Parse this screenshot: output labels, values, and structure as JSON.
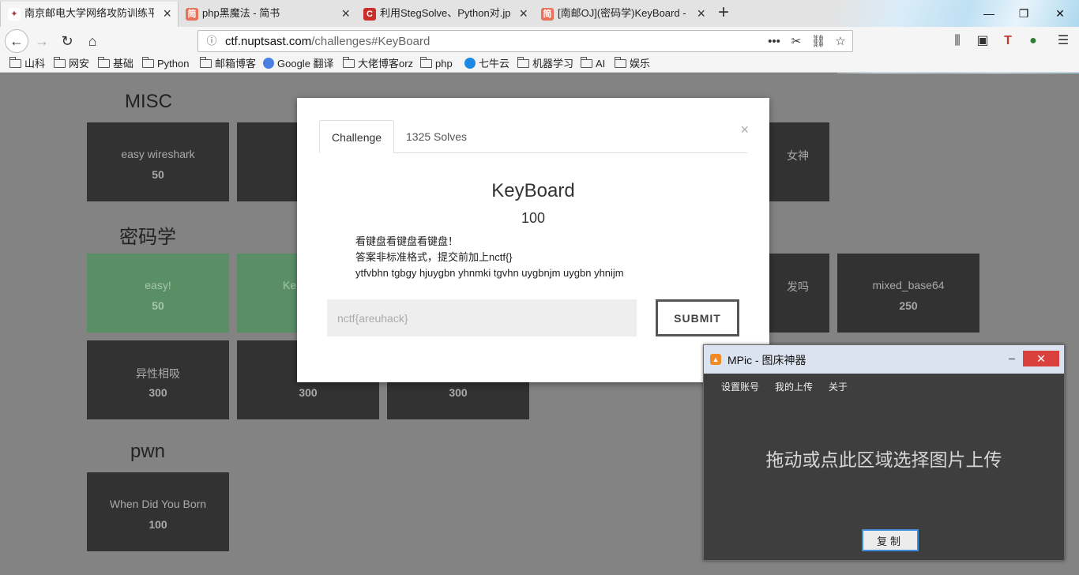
{
  "browser": {
    "tabs": [
      {
        "title": "南京邮电大学网络攻防训练平台",
        "favicon": "bird-icon",
        "color": "#a83b3b",
        "active": true
      },
      {
        "title": "php黑魔法 - 简书",
        "favicon": "jianshu-icon",
        "color": "#e8715a",
        "active": false
      },
      {
        "title": "利用StegSolve、Python对.jpg",
        "favicon": "csdn-icon",
        "color": "#c9302c",
        "active": false
      },
      {
        "title": "[南邮OJ](密码学)KeyBoard - 简书",
        "favicon": "jianshu-icon",
        "color": "#e8715a",
        "active": false
      }
    ],
    "url_host": "ctf.nuptsast.com",
    "url_path": "/challenges#KeyBoard",
    "bookmarks": [
      {
        "label": "山科",
        "type": "folder"
      },
      {
        "label": "网安",
        "type": "folder"
      },
      {
        "label": "基础",
        "type": "folder"
      },
      {
        "label": "Python",
        "type": "folder"
      },
      {
        "label": "邮箱博客",
        "type": "folder"
      },
      {
        "label": "Google 翻译",
        "type": "google"
      },
      {
        "label": "大佬博客orz",
        "type": "folder"
      },
      {
        "label": "php",
        "type": "folder"
      },
      {
        "label": "七牛云",
        "type": "qiniu"
      },
      {
        "label": "机器学习",
        "type": "folder"
      },
      {
        "label": "AI",
        "type": "folder"
      },
      {
        "label": "娱乐",
        "type": "folder"
      }
    ]
  },
  "page": {
    "categories": [
      {
        "title": "MISC"
      },
      {
        "title": "密码学"
      },
      {
        "title": "pwn"
      }
    ],
    "cards": {
      "misc_0": {
        "name": "easy wireshark",
        "value": "50"
      },
      "misc_far": {
        "name": "女神",
        "value": ""
      },
      "crypto_0": {
        "name": "easy!",
        "value": "50"
      },
      "crypto_1": {
        "name": "Ke",
        "value": ""
      },
      "crypto_far": {
        "name": "发吗",
        "value": ""
      },
      "crypto_last": {
        "name": "mixed_base64",
        "value": "250"
      },
      "crypto2_0": {
        "name": "异性相吸",
        "value": "300"
      },
      "crypto2_1": {
        "name": "",
        "value": "300"
      },
      "crypto2_2": {
        "name": "",
        "value": "300"
      },
      "pwn_0": {
        "name": "When Did You Born",
        "value": "100"
      }
    }
  },
  "modal": {
    "tab_challenge": "Challenge",
    "tab_solves": "1325 Solves",
    "name": "KeyBoard",
    "value": "100",
    "description": [
      "看键盘看键盘看键盘！",
      "答案非标准格式，提交前加上nctf{}",
      "ytfvbhn tgbgy hjuygbn yhnmki tgvhn uygbnjm uygbn yhnijm"
    ],
    "input_placeholder": "nctf{areuhack}",
    "submit_label": "SUBMIT",
    "close": "×"
  },
  "mpic": {
    "title": "MPic - 图床神器",
    "menu": [
      "设置账号",
      "我的上传",
      "关于"
    ],
    "drop_text": "拖动或点此区域选择图片上传",
    "copy_label": "复制"
  }
}
